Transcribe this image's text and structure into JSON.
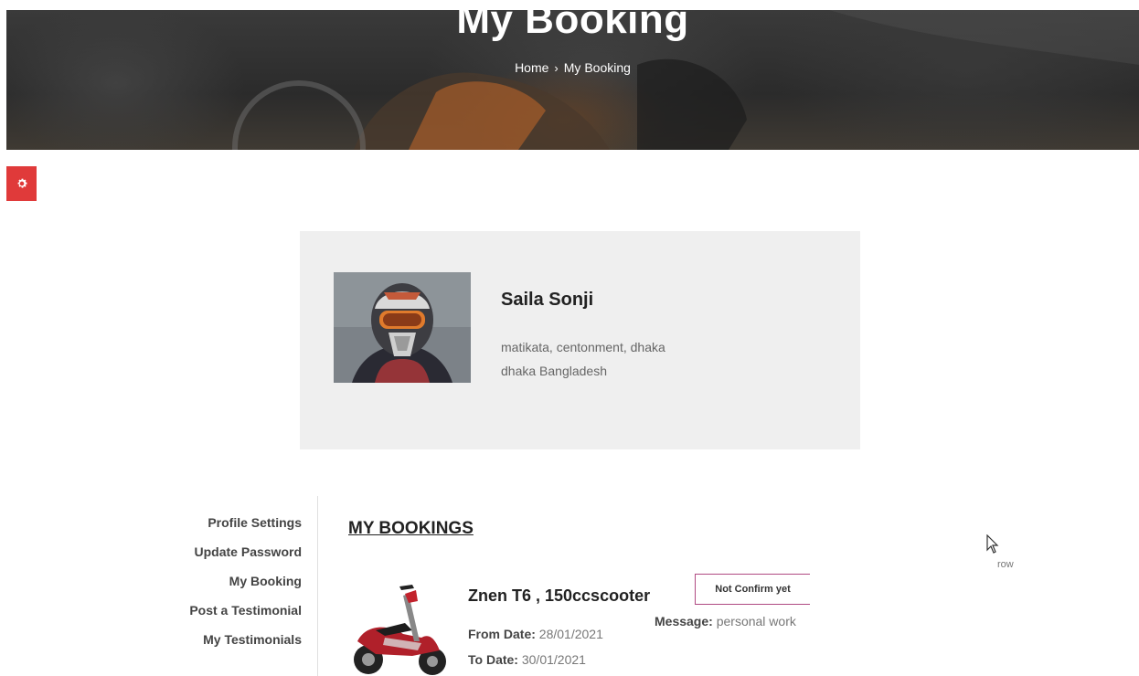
{
  "hero": {
    "title": "My Booking",
    "breadcrumb": {
      "home": "Home",
      "separator": "›",
      "current": "My Booking"
    }
  },
  "gear_button": {
    "icon": "gear-icon",
    "color": "#e03a3a"
  },
  "profile": {
    "name": "Saila Sonji",
    "address_line1": "matikata, centonment, dhaka",
    "address_line2": "dhaka Bangladesh"
  },
  "sidebar": {
    "items": [
      {
        "label": "Profile Settings"
      },
      {
        "label": "Update Password"
      },
      {
        "label": "My Booking"
      },
      {
        "label": "Post a Testimonial"
      },
      {
        "label": "My Testimonials"
      }
    ]
  },
  "bookings": {
    "heading": "MY BOOKINGS",
    "items": [
      {
        "vehicle": "Znen T6 , 150ccscooter",
        "from_label": "From Date:",
        "from_value": "28/01/2021",
        "to_label": "To Date:",
        "to_value": "30/01/2021",
        "status": "Not Confirm yet",
        "message_label": "Message:",
        "message_value": "personal work"
      }
    ]
  },
  "stray_text": "row"
}
